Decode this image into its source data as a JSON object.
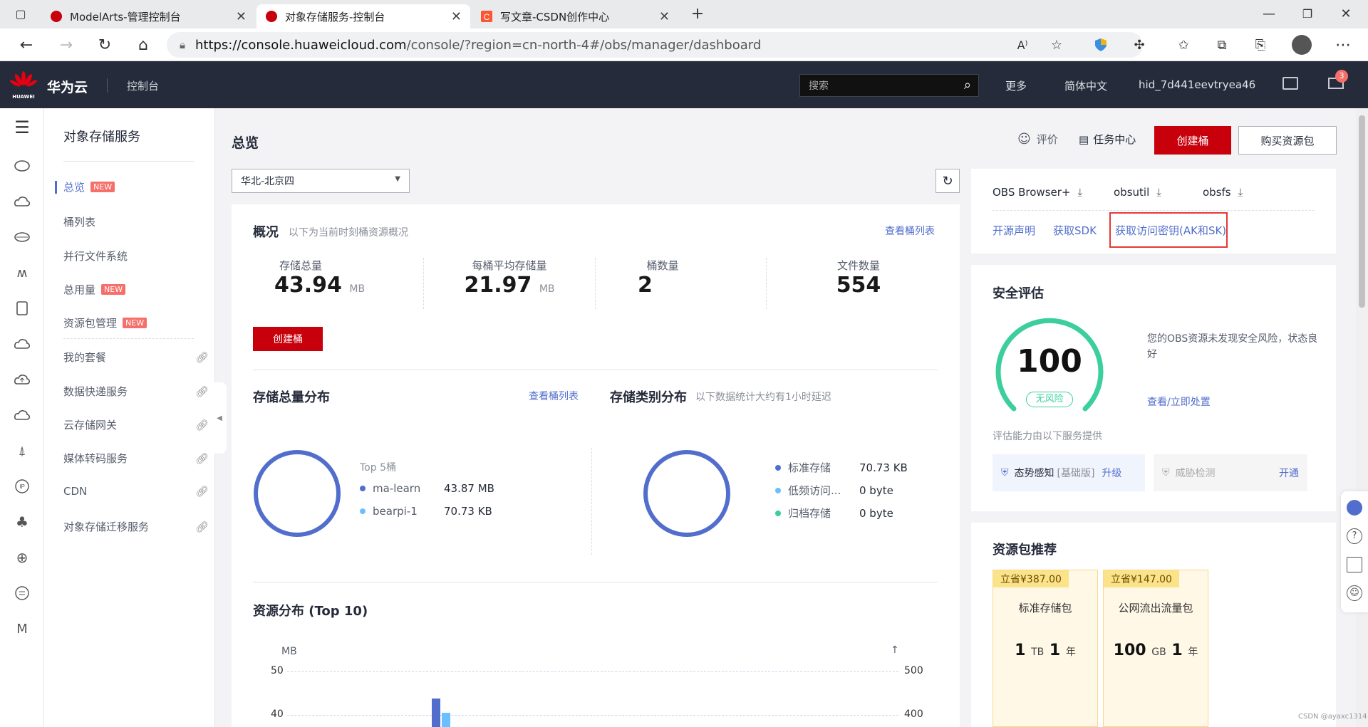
{
  "browser": {
    "tabs": [
      {
        "title": "ModelArts-管理控制台"
      },
      {
        "title": "对象存储服务-控制台"
      },
      {
        "title": "写文章-CSDN创作中心"
      }
    ],
    "url_host": "https://console.huaweicloud.com",
    "url_path": "/console/?region=cn-north-4#/obs/manager/dashboard",
    "avatar": ""
  },
  "header": {
    "brand": "华为云",
    "logo_text": "HUAWEI",
    "console": "控制台",
    "search_placeholder": "搜索",
    "more": "更多",
    "language": "简体中文",
    "user": "hid_7d441eevtryea46",
    "mail_count": "3"
  },
  "nav": {
    "title": "对象存储服务",
    "items": [
      {
        "label": "总览",
        "badge": "NEW"
      },
      {
        "label": "桶列表"
      },
      {
        "label": "并行文件系统"
      },
      {
        "label": "总用量",
        "badge": "NEW"
      },
      {
        "label": "资源包管理",
        "badge": "NEW"
      },
      {
        "label": "我的套餐"
      },
      {
        "label": "数据快递服务"
      },
      {
        "label": "云存储网关"
      },
      {
        "label": "媒体转码服务"
      },
      {
        "label": "CDN"
      },
      {
        "label": "对象存储迁移服务"
      }
    ]
  },
  "page": {
    "title": "总览",
    "rate": "评价",
    "task_center": "任务中心",
    "create_bucket": "创建桶",
    "buy_package": "购买资源包",
    "region": "华北-北京四"
  },
  "overview": {
    "title": "概况",
    "subtitle": "以下为当前时刻桶资源概况",
    "view_buckets": "查看桶列表",
    "stats": [
      {
        "label": "存储总量",
        "value": "43.94",
        "unit": "MB"
      },
      {
        "label": "每桶平均存储量",
        "value": "21.97",
        "unit": "MB"
      },
      {
        "label": "桶数量",
        "value": "2",
        "unit": ""
      },
      {
        "label": "文件数量",
        "value": "554",
        "unit": ""
      }
    ],
    "create_bucket": "创建桶"
  },
  "storage_dist": {
    "title": "存储总量分布",
    "view_buckets": "查看桶列表",
    "top": "Top 5桶",
    "rows": [
      {
        "name": "ma-learn",
        "value": "43.87 MB",
        "color": "#526ecc"
      },
      {
        "name": "bearpi-1",
        "value": "70.73 KB",
        "color": "#6cbfff"
      }
    ]
  },
  "class_dist": {
    "title": "存储类别分布",
    "subtitle": "以下数据统计大约有1小时延迟",
    "rows": [
      {
        "name": "标准存储",
        "value": "70.73 KB",
        "color": "#526ecc"
      },
      {
        "name": "低频访问...",
        "value": "0 byte",
        "color": "#6cbfff"
      },
      {
        "name": "归档存储",
        "value": "0 byte",
        "color": "#3ccf9b"
      }
    ]
  },
  "resource": {
    "title": "资源分布 (Top 10)",
    "chart_data": {
      "type": "bar",
      "ylabel": "MB",
      "y_ticks": [
        "50",
        "40"
      ],
      "y2_ticks": [
        "500",
        "400"
      ]
    }
  },
  "tools": {
    "items": [
      "OBS Browser+",
      "obsutil",
      "obsfs"
    ],
    "links": [
      "开源声明",
      "获取SDK",
      "获取访问密钥(AK和SK)"
    ]
  },
  "security": {
    "title": "安全评估",
    "score": "100",
    "level": "无风险",
    "desc": "您的OBS资源未发现安全风险，状态良好",
    "action": "查看/立即处置",
    "provider": "评估能力由以下服务提供",
    "svc1": {
      "name": "态势感知",
      "edition": "[基础版]",
      "action": "升级"
    },
    "svc2": {
      "name": "威胁检测",
      "action": "开通"
    }
  },
  "packages": {
    "title": "资源包推荐",
    "items": [
      {
        "save": "立省¥387.00",
        "name": "标准存储包",
        "size": "1",
        "size_unit": "TB",
        "years": "1",
        "year_unit": "年"
      },
      {
        "save": "立省¥147.00",
        "name": "公网流出流量包",
        "size": "100",
        "size_unit": "GB",
        "years": "1",
        "year_unit": "年"
      }
    ]
  },
  "watermark": "CSDN @ayaxc1314"
}
